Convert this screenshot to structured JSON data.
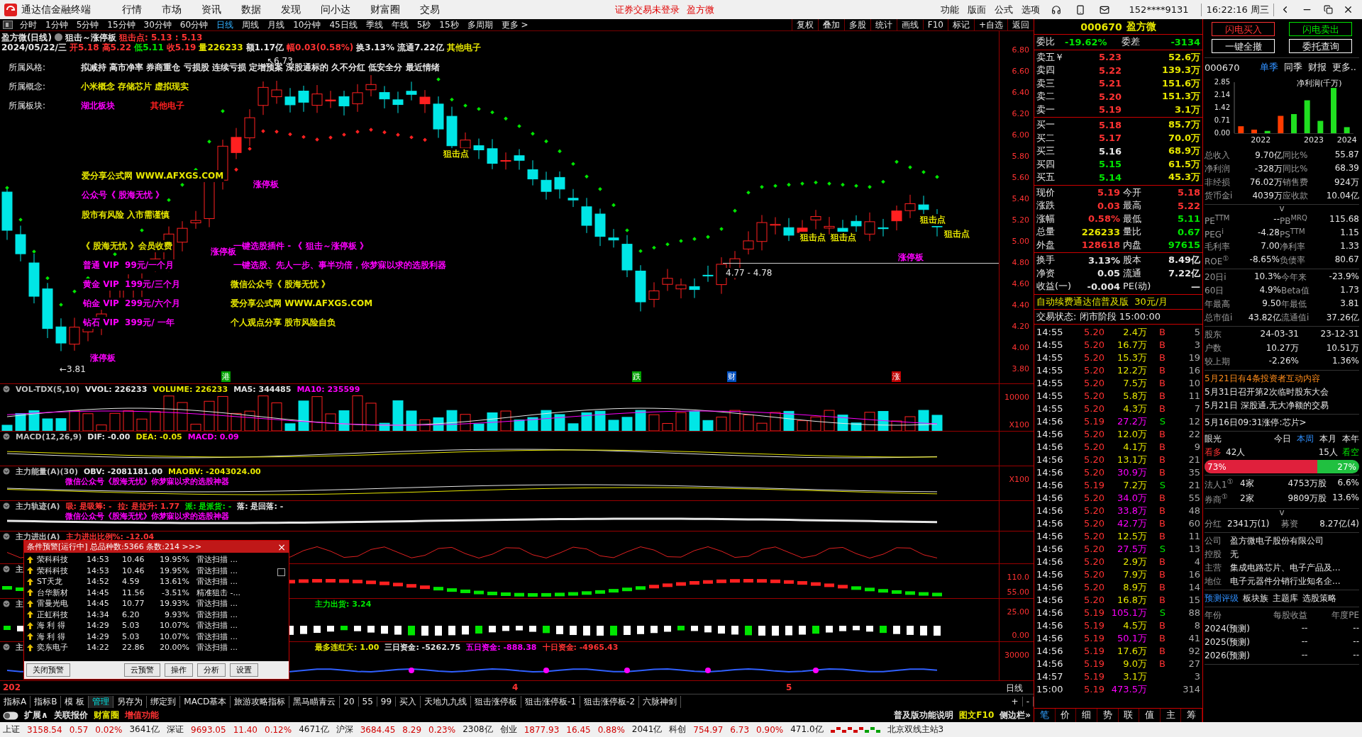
{
  "app": {
    "title": "通达信金融终端",
    "menu": [
      "行情",
      "市场",
      "资讯",
      "数据",
      "发现",
      "问小达",
      "财富圈",
      "交易"
    ],
    "notice": [
      "证券交易未登录",
      "盈方微"
    ],
    "tools": [
      "功能",
      "版面",
      "公式",
      "选项"
    ],
    "account": "152****9131",
    "clock": "16:22:16 周三"
  },
  "periods": [
    {
      "label": "分时",
      "selected": false
    },
    {
      "label": "1分钟",
      "selected": false
    },
    {
      "label": "5分钟",
      "selected": false
    },
    {
      "label": "15分钟",
      "selected": false
    },
    {
      "label": "30分钟",
      "selected": false
    },
    {
      "label": "60分钟",
      "selected": false
    },
    {
      "label": "日线",
      "selected": true
    },
    {
      "label": "周线",
      "selected": false
    },
    {
      "label": "月线",
      "selected": false
    },
    {
      "label": "10分钟",
      "selected": false
    },
    {
      "label": "45日线",
      "selected": false
    },
    {
      "label": "季线",
      "selected": false
    },
    {
      "label": "年线",
      "selected": false
    },
    {
      "label": "5秒",
      "selected": false
    },
    {
      "label": "15秒",
      "selected": false
    },
    {
      "label": "多周期",
      "selected": false
    },
    {
      "label": "更多 >",
      "selected": false
    }
  ],
  "chart_tools": [
    "复权",
    "叠加",
    "多股",
    "统计",
    "画线",
    "F10",
    "标记",
    "+自选",
    "返回"
  ],
  "chart": {
    "title": "盈方微(日线)",
    "formula": "狙击～涨停板",
    "sniper": "狙击点: 5.13 : 5.13",
    "stats": [
      {
        "text": "2024/05/22/三",
        "color": "#e6e6e6"
      },
      {
        "text": "开5.18",
        "color": "#ff3232"
      },
      {
        "text": "高5.22",
        "color": "#ff3232"
      },
      {
        "text": "低5.11",
        "color": "#00e600"
      },
      {
        "text": "收5.19",
        "color": "#ff3232"
      },
      {
        "text": "量226233",
        "color": "#e6e600"
      },
      {
        "text": "额1.17亿",
        "color": "#e6e6e6"
      },
      {
        "text": "幅0.03(0.58%)",
        "color": "#ff3232"
      },
      {
        "text": "换3.13%",
        "color": "#e6e6e6"
      },
      {
        "text": "流通7.22亿",
        "color": "#e6e6e6"
      },
      {
        "text": "其他电子",
        "color": "#e6e600"
      }
    ],
    "info": [
      {
        "label": "所属风格:",
        "value": "拟减持 高市净率 券商重仓 亏损股 连续亏损 定增预案 深股通标的 久不分红 低安全分 最近情绪",
        "color": "#e6e6e6"
      },
      {
        "label": "所属概念:",
        "value": "小米概念 存储芯片 虚拟现实",
        "color": "#e6e600"
      }
    ],
    "sectors": {
      "label": "所属板块:",
      "items": [
        {
          "text": "湖北板块",
          "color": "#ff00ff"
        },
        {
          "text": "其他电子",
          "color": "#ff2020"
        }
      ]
    },
    "annotations": [
      {
        "text": "爱分享公式网 WWW.AFXGS.COM",
        "color": "#e6e600"
      },
      {
        "text": "公众号《 股海无忧 》",
        "color": "#ff00ff"
      },
      {
        "text": "股市有风险 入市需谨慎",
        "color": "#e6e600"
      },
      {
        "text": "《 股海无忧 》会员收费",
        "color": "#e6e600"
      },
      {
        "text": "普通 VIP  99元/一个月",
        "color": "#ff00ff"
      },
      {
        "text": "黄金 VIP  199元/三个月",
        "color": "#ff00ff"
      },
      {
        "text": "铂金 VIP  299元/六个月",
        "color": "#ff00ff"
      },
      {
        "text": "钻石 VIP  399元/ 一年",
        "color": "#ff00ff"
      },
      {
        "text": "一键选股插件 - 《 狙击～涨停板 》",
        "color": "#ff00ff"
      },
      {
        "text": "一键选股、先人一步、事半功倍，你梦寐以求的选股利器",
        "color": "#ff00ff"
      },
      {
        "text": "微信公众号《 股海无忧 》",
        "color": "#e6e600"
      },
      {
        "text": "爱分享公式网 WWW.AFXGS.COM",
        "color": "#e6e600"
      },
      {
        "text": "个人观点分享 股市风险自负",
        "color": "#e6e600"
      }
    ],
    "signals": [
      {
        "text": "狙击点",
        "kind": "sniper"
      },
      {
        "text": "涨停板",
        "kind": "limit"
      },
      {
        "text": "涨停板",
        "kind": "limit"
      },
      {
        "text": "涨停板",
        "kind": "limit"
      },
      {
        "text": "涨停板",
        "kind": "limit"
      },
      {
        "text": "狙击点",
        "kind": "sniper"
      },
      {
        "text": "狙击点",
        "kind": "sniper"
      },
      {
        "text": "狙击点",
        "kind": "sniper"
      },
      {
        "text": "狙击点",
        "kind": "sniper"
      }
    ],
    "events": [
      {
        "text": "港",
        "color": "#00a000"
      },
      {
        "text": "跌",
        "color": "#00a000"
      },
      {
        "text": "财",
        "color": "#0050c0"
      },
      {
        "text": "涨",
        "color": "#c00000"
      }
    ],
    "high": "↖6.73",
    "low": "←3.81",
    "range": "4.77 - 4.78",
    "price_ticks": [
      "6.80",
      "6.60",
      "6.40",
      "6.20",
      "6.00",
      "5.80",
      "5.60",
      "5.40",
      "5.20",
      "5.00",
      "4.80",
      "4.60",
      "4.40",
      "4.20",
      "4.00",
      "3.80"
    ]
  },
  "panels": [
    {
      "kind": "volume",
      "segments": [
        {
          "text": "VOL-TDX(5,10)",
          "color": "#c0c0c0"
        },
        {
          "text": "VVOL: 226233",
          "color": "#e6e6e6"
        },
        {
          "text": "VOLUME: 226233",
          "color": "#e6e600"
        },
        {
          "text": "MA5: 344485",
          "color": "#e6e6e6"
        },
        {
          "text": "MA10: 235599",
          "color": "#ff00ff"
        }
      ],
      "axis": [
        "10000",
        "X100"
      ]
    },
    {
      "kind": "macd",
      "segments": [
        {
          "text": "MACD(12,26,9)",
          "color": "#c0c0c0"
        },
        {
          "text": "DIF: -0.00",
          "color": "#e6e6e6"
        },
        {
          "text": "DEA: -0.05",
          "color": "#e6e600"
        },
        {
          "text": "MACD: 0.09",
          "color": "#ff00ff"
        }
      ]
    },
    {
      "kind": "energy",
      "segments": [
        {
          "text": "主力能量(A)(30)",
          "color": "#c0c0c0"
        },
        {
          "text": "OBV: -2081181.00",
          "color": "#e6e6e6"
        },
        {
          "text": "MAOBV: -2043024.00",
          "color": "#e6e600"
        }
      ],
      "overlay": "微信公众号《股海无忧》你梦寐以求的选股神器",
      "axis": [
        "X100"
      ]
    },
    {
      "kind": "track",
      "segments": [
        {
          "text": "主力轨迹(A)",
          "color": "#c0c0c0"
        },
        {
          "text": "吸: 是吸筹: -",
          "color": "#ff3232"
        },
        {
          "text": "拉: 是拉升: 1.77",
          "color": "#ff3232"
        },
        {
          "text": "派: 是派货: -",
          "color": "#00e600"
        },
        {
          "text": "落: 是回落: -",
          "color": "#e6e6e6"
        }
      ],
      "overlay": "微信公众号《股海无忧》你梦寐以求的选股神器"
    },
    {
      "kind": "wave",
      "segments": [
        {
          "text": "主力进出(A)",
          "color": "#c0c0c0"
        },
        {
          "text": "主力进出比例%: -12.04",
          "color": "#ff3232"
        }
      ]
    },
    {
      "kind": "blocks",
      "segments": [
        {
          "text": "主",
          "color": "#c0c0c0"
        }
      ],
      "axis": [
        "110.0",
        "55.00"
      ]
    },
    {
      "kind": "bars",
      "segments": [
        {
          "text": "主",
          "color": "#c0c0c0"
        }
      ],
      "tail": [
        {
          "text": "主力出货: 3.24",
          "color": "#00e600"
        }
      ],
      "axis": [
        "25.00",
        "0.00"
      ]
    },
    {
      "kind": "stars",
      "segments": [
        {
          "text": "主",
          "color": "#c0c0c0"
        }
      ],
      "tail": [
        {
          "text": "最多连红天: 1.00",
          "color": "#e6e600"
        },
        {
          "text": "三日资金: -5262.75",
          "color": "#e6e6e6"
        },
        {
          "text": "五日资金: -888.38",
          "color": "#ff00ff"
        },
        {
          "text": "十日资金: -4965.43",
          "color": "#ff3232"
        }
      ],
      "axis": [
        "30000"
      ]
    }
  ],
  "alert": {
    "title": "条件预警[运行中] 总品种数:5366 条数:214  >>>",
    "close": "×",
    "rows": [
      [
        "荣科科技",
        "14:53",
        "10.46",
        "19.95%",
        "雷达扫描 ..."
      ],
      [
        "荣科科技",
        "14:53",
        "10.46",
        "19.95%",
        "雷达扫描 ..."
      ],
      [
        "ST天龙",
        "14:52",
        "4.59",
        "13.61%",
        "雷达扫描 ..."
      ],
      [
        "台华新材",
        "14:45",
        "11.56",
        "-3.51%",
        "精准狙击 -..."
      ],
      [
        "雷曼光电",
        "14:45",
        "10.77",
        "19.93%",
        "雷达扫描 ..."
      ],
      [
        "正虹科技",
        "14:34",
        "6.20",
        "9.93%",
        "雷达扫描 ..."
      ],
      [
        "海 利 得",
        "14:29",
        "5.03",
        "10.07%",
        "雷达扫描 ..."
      ],
      [
        "海 利 得",
        "14:29",
        "5.03",
        "10.07%",
        "雷达扫描 ..."
      ],
      [
        "奕东电子",
        "14:22",
        "22.86",
        "20.00%",
        "雷达扫描 ..."
      ]
    ],
    "scroll_checked": false,
    "buttons": [
      "关闭预警",
      "云预警",
      "操作",
      "分析",
      "设置"
    ]
  },
  "date_axis": [
    "202",
    "4",
    "5"
  ],
  "axis_mode": "日线",
  "formula_tabs": [
    {
      "label": "指标A",
      "selected": false
    },
    {
      "label": "指标B",
      "selected": false
    },
    {
      "label": "模 板",
      "selected": false
    },
    {
      "label": "管理",
      "selected": true
    },
    {
      "label": "另存为",
      "selected": false
    },
    {
      "label": "绑定到",
      "selected": false
    },
    {
      "label": "MACD基本",
      "selected": false
    },
    {
      "label": "旅游攻略指标",
      "selected": false
    },
    {
      "label": "黑马瞄青云",
      "selected": false
    },
    {
      "label": "20",
      "selected": false
    },
    {
      "label": "55",
      "selected": false
    },
    {
      "label": "99",
      "selected": false
    },
    {
      "label": "买入",
      "selected": false
    },
    {
      "label": "天地九九线",
      "selected": false
    },
    {
      "label": "狙击涨停板",
      "selected": false
    },
    {
      "label": "狙击涨停板-1",
      "selected": false
    },
    {
      "label": "狙击涨停板-2",
      "selected": false
    },
    {
      "label": "六脉神剑",
      "selected": false
    }
  ],
  "zoom_buttons": [
    "+",
    "-"
  ],
  "ext_links": [
    {
      "text": "扩展∧",
      "color": "#e6e6e6"
    },
    {
      "text": "关联报价",
      "color": "#e6e6e6"
    },
    {
      "text": "财富圈",
      "color": "#e6e600"
    },
    {
      "text": "增值功能",
      "color": "#ff3232"
    }
  ],
  "ext_right": [
    {
      "text": "普及版功能说明",
      "color": "#e6e6e6"
    },
    {
      "text": "图文F10",
      "color": "#e6e600"
    },
    {
      "text": "侧边栏»",
      "color": "#e6e6e6"
    }
  ],
  "quote": {
    "code": "000670",
    "name": "盈方微",
    "spread": [
      {
        "label": "委比",
        "value": "-19.62%"
      },
      {
        "label": "委差",
        "value": "-3134"
      }
    ],
    "asks": [
      {
        "label": "卖五￥",
        "price": "5.23",
        "volume": "52.6万",
        "color": "#ff3232"
      },
      {
        "label": "卖四",
        "price": "5.22",
        "volume": "139.3万",
        "color": "#ff3232"
      },
      {
        "label": "卖三",
        "price": "5.21",
        "volume": "151.6万",
        "color": "#ff3232"
      },
      {
        "label": "卖二",
        "price": "5.20",
        "volume": "151.3万",
        "color": "#ff3232"
      },
      {
        "label": "卖一",
        "price": "5.19",
        "volume": "3.1万",
        "color": "#ff3232"
      }
    ],
    "bids": [
      {
        "label": "买一",
        "price": "5.18",
        "volume": "85.7万",
        "color": "#ff3232"
      },
      {
        "label": "买二",
        "price": "5.17",
        "volume": "70.0万",
        "color": "#ff3232"
      },
      {
        "label": "买三",
        "price": "5.16",
        "volume": "68.9万",
        "color": "#e6e6e6"
      },
      {
        "label": "买四",
        "price": "5.15",
        "volume": "61.5万",
        "color": "#00e600"
      },
      {
        "label": "买五",
        "price": "5.14",
        "volume": "45.3万",
        "color": "#00e600"
      }
    ],
    "stats": [
      [
        {
          "label": "现价",
          "value": "5.19",
          "color": "#ff3232"
        },
        {
          "label": "今开",
          "value": "5.18",
          "color": "#ff3232"
        }
      ],
      [
        {
          "label": "涨跌",
          "value": "0.03",
          "color": "#ff3232"
        },
        {
          "label": "最高",
          "value": "5.22",
          "color": "#ff3232"
        }
      ],
      [
        {
          "label": "涨幅",
          "value": "0.58%",
          "color": "#ff3232"
        },
        {
          "label": "最低",
          "value": "5.11",
          "color": "#00e600"
        }
      ],
      [
        {
          "label": "总量",
          "value": "226233",
          "color": "#e6e600"
        },
        {
          "label": "量比",
          "value": "0.67",
          "color": "#00e600"
        }
      ],
      [
        {
          "label": "外盘",
          "value": "128618",
          "color": "#ff3232"
        },
        {
          "label": "内盘",
          "value": "97615",
          "color": "#00e600"
        }
      ]
    ],
    "stats2": [
      [
        {
          "label": "换手",
          "value": "3.13%",
          "color": "#e6e6e6"
        },
        {
          "label": "股本",
          "value": "8.49亿",
          "color": "#e6e6e6"
        }
      ],
      [
        {
          "label": "净资",
          "value": "0.05",
          "color": "#e6e6e6"
        },
        {
          "label": "流通",
          "value": "7.22亿",
          "color": "#e6e6e6"
        }
      ],
      [
        {
          "label": "收益(一)",
          "value": "-0.004",
          "color": "#e6e6e6"
        },
        {
          "label": "PE(动)",
          "value": "—",
          "color": "#e6e6e6"
        }
      ]
    ],
    "ad": "自动续费通达信普及版  30元/月",
    "state": "交易状态: 闭市阶段 15:00:00",
    "ticks": [
      {
        "time": "14:55",
        "price": "5.20",
        "volume": "2.4万",
        "big": false,
        "side": "B",
        "count": "5"
      },
      {
        "time": "14:55",
        "price": "5.20",
        "volume": "16.7万",
        "big": false,
        "side": "B",
        "count": "3"
      },
      {
        "time": "14:55",
        "price": "5.20",
        "volume": "15.3万",
        "big": false,
        "side": "B",
        "count": "19"
      },
      {
        "time": "14:55",
        "price": "5.20",
        "volume": "12.2万",
        "big": false,
        "side": "B",
        "count": "16"
      },
      {
        "time": "14:55",
        "price": "5.20",
        "volume": "7.5万",
        "big": false,
        "side": "B",
        "count": "10"
      },
      {
        "time": "14:55",
        "price": "5.20",
        "volume": "5.8万",
        "big": false,
        "side": "B",
        "count": "11"
      },
      {
        "time": "14:55",
        "price": "5.20",
        "volume": "4.3万",
        "big": false,
        "side": "B",
        "count": "7"
      },
      {
        "time": "14:56",
        "price": "5.19",
        "volume": "27.2万",
        "big": true,
        "side": "S",
        "count": "12"
      },
      {
        "time": "14:56",
        "price": "5.20",
        "volume": "12.0万",
        "big": false,
        "side": "B",
        "count": "22"
      },
      {
        "time": "14:56",
        "price": "5.20",
        "volume": "4.1万",
        "big": false,
        "side": "B",
        "count": "9"
      },
      {
        "time": "14:56",
        "price": "5.20",
        "volume": "13.1万",
        "big": false,
        "side": "B",
        "count": "21"
      },
      {
        "time": "14:56",
        "price": "5.20",
        "volume": "30.9万",
        "big": true,
        "side": "B",
        "count": "35"
      },
      {
        "time": "14:56",
        "price": "5.19",
        "volume": "7.2万",
        "big": false,
        "side": "S",
        "count": "21"
      },
      {
        "time": "14:56",
        "price": "5.20",
        "volume": "34.0万",
        "big": true,
        "side": "B",
        "count": "55"
      },
      {
        "time": "14:56",
        "price": "5.20",
        "volume": "33.8万",
        "big": true,
        "side": "B",
        "count": "48"
      },
      {
        "time": "14:56",
        "price": "5.20",
        "volume": "42.7万",
        "big": true,
        "side": "B",
        "count": "60"
      },
      {
        "time": "14:56",
        "price": "5.20",
        "volume": "12.5万",
        "big": false,
        "side": "B",
        "count": "11"
      },
      {
        "time": "14:56",
        "price": "5.20",
        "volume": "27.5万",
        "big": true,
        "side": "S",
        "count": "13"
      },
      {
        "time": "14:56",
        "price": "5.20",
        "volume": "2.9万",
        "big": false,
        "side": "B",
        "count": "4"
      },
      {
        "time": "14:56",
        "price": "5.20",
        "volume": "7.9万",
        "big": false,
        "side": "B",
        "count": "16"
      },
      {
        "time": "14:56",
        "price": "5.20",
        "volume": "8.9万",
        "big": false,
        "side": "B",
        "count": "14"
      },
      {
        "time": "14:56",
        "price": "5.20",
        "volume": "16.8万",
        "big": false,
        "side": "B",
        "count": "15"
      },
      {
        "time": "14:56",
        "price": "5.19",
        "volume": "105.1万",
        "big": true,
        "side": "S",
        "count": "88"
      },
      {
        "time": "14:56",
        "price": "5.19",
        "volume": "4.5万",
        "big": false,
        "side": "B",
        "count": "8"
      },
      {
        "time": "14:56",
        "price": "5.19",
        "volume": "50.1万",
        "big": true,
        "side": "B",
        "count": "41"
      },
      {
        "time": "14:56",
        "price": "5.19",
        "volume": "17.6万",
        "big": false,
        "side": "B",
        "count": "92"
      },
      {
        "time": "14:56",
        "price": "5.19",
        "volume": "9.0万",
        "big": false,
        "side": "B",
        "count": "27"
      },
      {
        "time": "14:57",
        "price": "5.19",
        "volume": "3.1万",
        "big": false,
        "count": "3"
      },
      {
        "time": "15:00",
        "price": "5.19",
        "volume": "473.5万",
        "big": true,
        "count": "314"
      }
    ],
    "tabs": [
      {
        "label": "笔",
        "selected": true
      },
      {
        "label": "价",
        "selected": false
      },
      {
        "label": "细",
        "selected": false
      },
      {
        "label": "势",
        "selected": false
      },
      {
        "label": "联",
        "selected": false
      },
      {
        "label": "值",
        "selected": false
      },
      {
        "label": "主",
        "selected": false
      },
      {
        "label": "筹",
        "selected": false
      }
    ]
  },
  "f10": {
    "trade_buttons": [
      {
        "label": "闪电买入",
        "kind": "buy"
      },
      {
        "label": "闪电卖出",
        "kind": "sell"
      },
      {
        "label": "一键全撤",
        "kind": "plain"
      },
      {
        "label": "委托查询",
        "kind": "plain"
      }
    ],
    "code": "000670",
    "tabs": [
      {
        "label": "单季",
        "selected": true
      },
      {
        "label": "同季",
        "selected": false
      },
      {
        "label": "财报",
        "selected": false
      },
      {
        "label": "更多..",
        "selected": false
      }
    ],
    "chart_data": {
      "type": "bar",
      "title": "净利润(千万)",
      "categories": [
        null,
        "2022",
        null,
        null,
        null,
        "2023",
        null,
        null,
        "2024"
      ],
      "stacked": true,
      "yticks": [
        {
          "value": 0,
          "label": "0.00"
        },
        {
          "value": 0.71,
          "label": "0.71"
        },
        {
          "value": 1.42,
          "label": "1.42"
        },
        {
          "value": 2.14,
          "label": "2.14"
        },
        {
          "value": 2.85,
          "label": "2.85"
        }
      ],
      "ylim": [
        0,
        2.85
      ],
      "series": [
        {
          "color": "#ff3c00",
          "values": [
            0.39,
            0.2,
            null,
            0.97,
            null,
            null,
            null,
            null,
            null
          ]
        },
        {
          "color": "#20e020",
          "values": [
            null,
            null,
            0.13,
            null,
            1.07,
            1.84,
            0.69,
            2.53,
            0.34
          ]
        }
      ]
    },
    "finance": [
      [
        "总收入",
        "9.70亿",
        "同比%",
        "55.87"
      ],
      [
        "净利润",
        "-328万",
        "同比%",
        "68.39"
      ],
      [
        "非经损",
        "76.02万",
        "销售费",
        "924万"
      ],
      [
        "货币金i",
        "4039万",
        "应收款",
        "10.04亿"
      ]
    ],
    "expand": "v",
    "valuation": [
      [
        "PE$^{TTM}$",
        "--",
        "PB$^{MRQ}$",
        "115.68"
      ],
      [
        "PEG$^{i}$",
        "-4.28",
        "PS$^{TTM}$",
        "1.15"
      ],
      [
        "毛利率",
        "7.00",
        "净利率",
        "1.33"
      ],
      [
        "ROE$^{①}$",
        "-8.65%",
        "负债率",
        "80.67"
      ]
    ],
    "performance": [
      [
        "20日i",
        "10.3%",
        "今年来",
        "-23.9%"
      ],
      [
        "60日",
        "4.9%",
        "Beta值",
        "1.73"
      ],
      [
        "年最高",
        "9.50",
        "年最低",
        "3.81"
      ],
      [
        "总市值i",
        "43.82亿",
        "流通值i",
        "37.26亿"
      ]
    ],
    "holders": [
      [
        "股东",
        "24-03-31",
        "23-12-31"
      ],
      [
        "户数",
        "10.27万",
        "10.51万"
      ],
      [
        "较上期",
        "-2.26%",
        "1.36%"
      ]
    ],
    "news": [
      {
        "text": "5月21日有4条投资者互动内容",
        "color": "#ff8c1a"
      },
      {
        "text": "5月31日召开第2次临时股东大会",
        "color": "#e6e6e6"
      },
      {
        "text": "5月21日 深股通,无大净额的交易",
        "color": "#e6e6e6"
      }
    ],
    "limit_news": "5月16日09:31涨停:芯片>",
    "vision": {
      "label": "眼光",
      "tabs": [
        {
          "label": "今日",
          "selected": false
        },
        {
          "label": "本周",
          "selected": true
        },
        {
          "label": "本月",
          "selected": false
        },
        {
          "label": "本年",
          "selected": false
        }
      ],
      "bull_label": "看多",
      "bull_count": "42人",
      "bear_count": "15人",
      "bear_label": "看空",
      "level": 0.73,
      "bull_pct": "73%",
      "bear_pct": "27%"
    },
    "institutions": [
      [
        "法人1$^{①}$",
        "4家",
        "4753万股",
        "6.6%"
      ],
      [
        "券商$^{①}$",
        "2家",
        "9809万股",
        "13.6%"
      ]
    ],
    "expand2": "v",
    "dividend": [
      "分红",
      "2341万(1)",
      "募资",
      "8.27亿(4)"
    ],
    "company": [
      [
        "公司",
        "盈方微电子股份有限公司"
      ],
      [
        "控股",
        "无"
      ],
      [
        "主营",
        "集成电路芯片、电子产品及..."
      ],
      [
        "地位",
        "电子元器件分销行业知名企..."
      ]
    ],
    "links": [
      {
        "label": "预测评级",
        "selected": true
      },
      {
        "label": "板块族",
        "selected": false
      },
      {
        "label": "主题库",
        "selected": false
      },
      {
        "label": "选股策略",
        "selected": false
      }
    ],
    "forecast_head": [
      "年份",
      "每股收益",
      "年度PE"
    ],
    "forecast": [
      [
        "2024(预测)",
        "--",
        "--"
      ],
      [
        "2025(预测)",
        "--",
        "--"
      ],
      [
        "2026(预测)",
        "--",
        "--"
      ]
    ]
  },
  "indices": [
    {
      "name": "上证",
      "value": "3158.54",
      "change": "0.57",
      "pct": "0.02%",
      "amount": "3641亿"
    },
    {
      "name": "深证",
      "value": "9693.05",
      "change": "11.40",
      "pct": "0.12%",
      "amount": "4671亿"
    },
    {
      "name": "沪深",
      "value": "3684.45",
      "change": "8.29",
      "pct": "0.23%",
      "amount": "2308亿"
    },
    {
      "name": "创业",
      "value": "1877.93",
      "change": "16.45",
      "pct": "0.88%",
      "amount": "2041亿"
    },
    {
      "name": "科创",
      "value": "754.97",
      "change": "6.73",
      "pct": "0.90%",
      "amount": "471.0亿"
    }
  ],
  "server": "北京双线主站3"
}
